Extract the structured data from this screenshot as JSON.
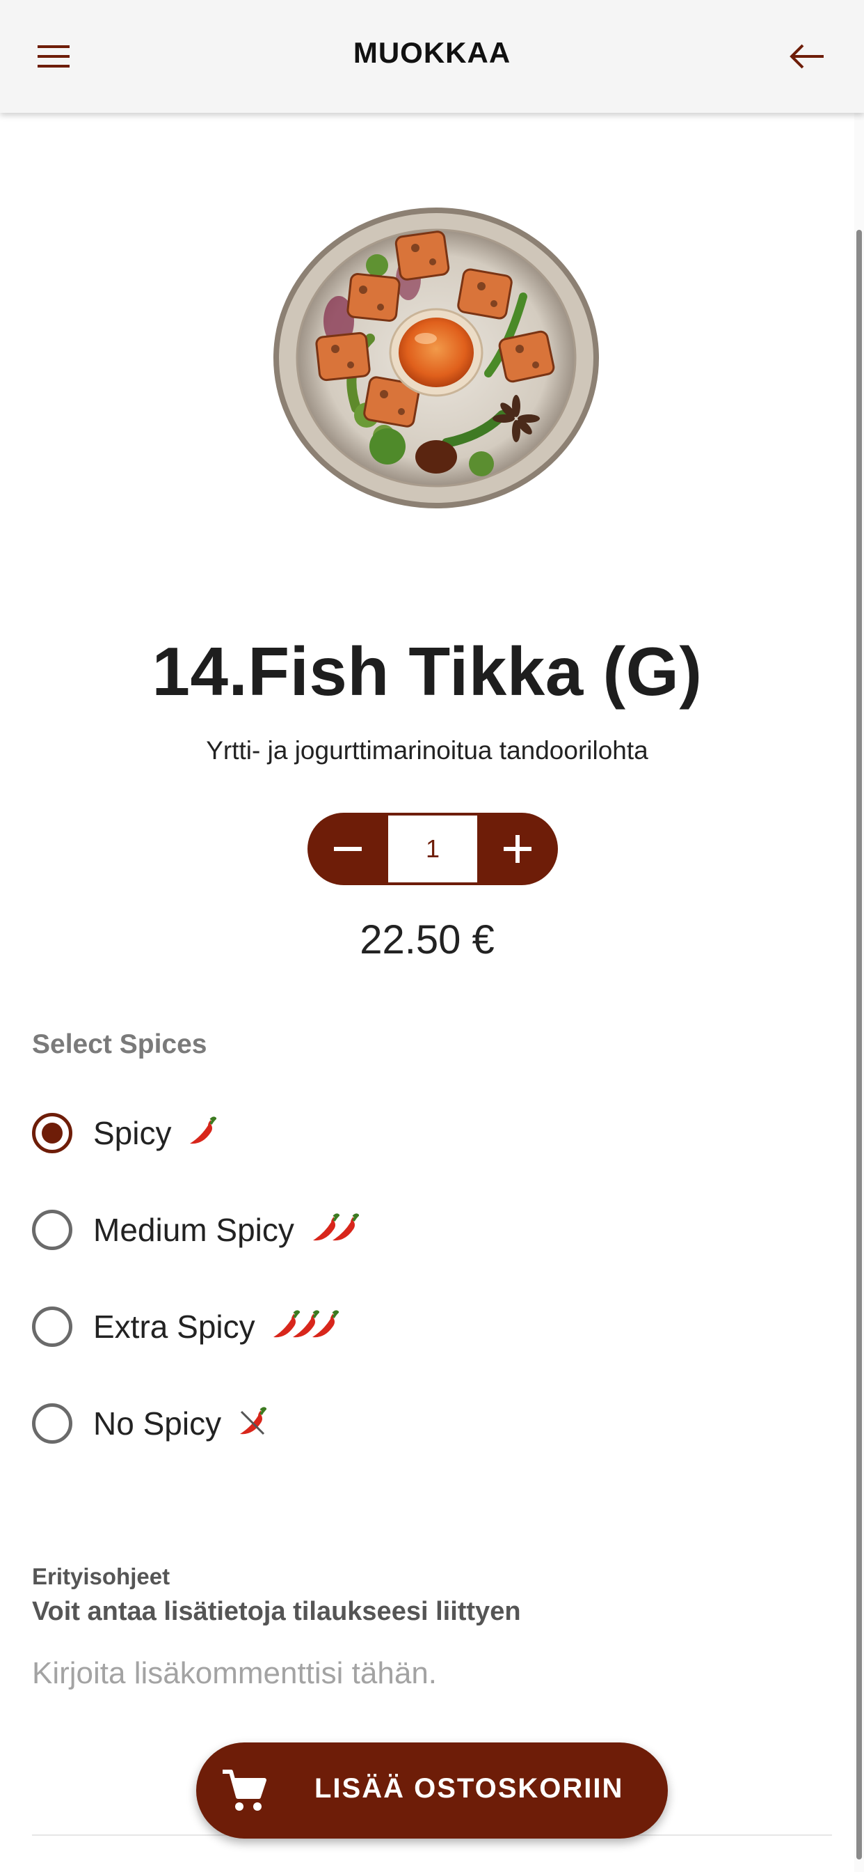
{
  "header": {
    "title": "MUOKKAA",
    "menu_icon": "hamburger-menu-icon",
    "back_icon": "arrow-left-icon"
  },
  "product": {
    "name": "14.Fish Tikka (G)",
    "description": "Yrtti- ja jogurttimarinoitua tandoorilohta",
    "quantity": "1",
    "price": "22.50 €"
  },
  "spices": {
    "label": "Select Spices",
    "selected": 0,
    "options": [
      {
        "label": "Spicy",
        "chili_count": 1
      },
      {
        "label": "Medium Spicy",
        "chili_count": 2
      },
      {
        "label": "Extra Spicy",
        "chili_count": 3
      },
      {
        "label": "No Spicy",
        "chili_count": 1
      }
    ]
  },
  "notes": {
    "title": "Erityisohjeet",
    "subtitle": "Voit antaa lisätietoja tilaukseesi liittyen",
    "placeholder": "Kirjoita lisäkommenttisi tähän.",
    "value": ""
  },
  "cart_button": {
    "label": "LISÄÄ OSTOSKORIIN",
    "icon": "shopping-cart-icon"
  },
  "colors": {
    "accent": "#6e1d08",
    "header_bg": "#f5f5f5",
    "muted_text": "#7a7a7a"
  }
}
